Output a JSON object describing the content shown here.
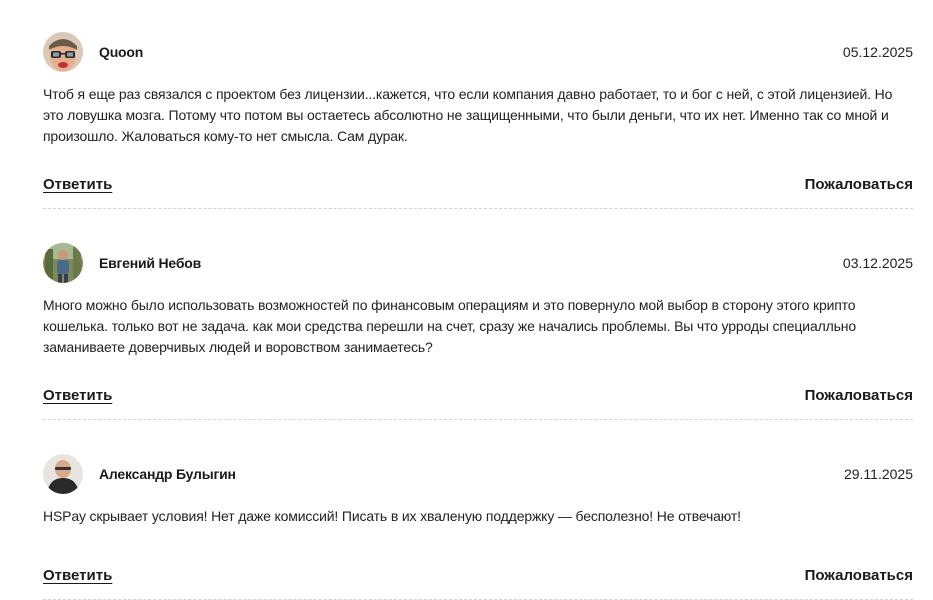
{
  "comments": [
    {
      "author": "Quoon",
      "date": "05.12.2025",
      "text": "Чтоб я еще раз связался с проектом без лицензии...кажется, что если компания давно работает, то и бог с ней, с этой лицензией. Но это ловушка мозга. Потому что потом вы остаетесь абсолютно не защищенными, что были деньги, что их нет. Именно так со мной и произошло. Жаловаться кому-то нет смысла. Сам дурак.",
      "reply_label": "Ответить",
      "report_label": "Пожаловаться",
      "avatar_icon": "avatar-glasses-man-icon"
    },
    {
      "author": "Евгений Небов",
      "date": "03.12.2025",
      "text": "Много можно было использовать возможностей по финансовым операциям и это повернуло мой выбор в сторону этого крипто кошелька. только вот не задача. как мои средства перешли на счет, сразу же начались проблемы. Вы что урроды специалльно заманиваете доверчивых людей и воровством занимаетесь?",
      "reply_label": "Ответить",
      "report_label": "Пожаловаться",
      "avatar_icon": "avatar-outdoor-man-icon"
    },
    {
      "author": "Александр Булыгин",
      "date": "29.11.2025",
      "text": "HSPay скрывает условия! Нет даже комиссий! Писать в их хваленую поддержку — бесполезно! Не отвечают!",
      "reply_label": "Ответить",
      "report_label": "Пожаловаться",
      "avatar_icon": "avatar-bald-man-icon"
    }
  ]
}
